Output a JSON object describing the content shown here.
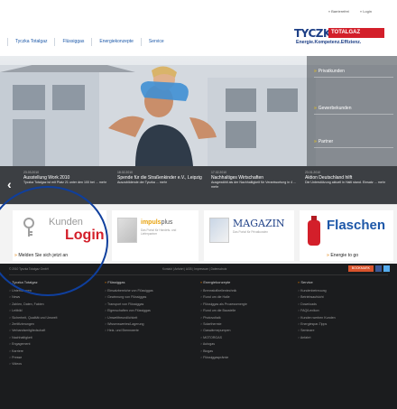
{
  "header": {
    "top_links": [
      "» Barrierefrei",
      "» Login"
    ],
    "nav": [
      "Tyczka Totalgaz",
      "Flüssiggas",
      "Energiekonzepte",
      "Service"
    ],
    "logo": {
      "brand": "TYCZKA",
      "sub": "TOTALGAZ",
      "slogan": "Energie.Kompetenz.Effizienz."
    },
    "colors": {
      "brand_blue": "#1d3f86",
      "brand_red": "#d31f2a"
    }
  },
  "hero": {
    "side_links": [
      "Privatkunden",
      "Gewerbekunden",
      "Partner"
    ]
  },
  "news": [
    {
      "date": "23.03.2010",
      "title": "Ausstellung Work 2010",
      "text": "Tyczka Totalgaz ist mit Platz 21 unter den 100 bei ... mehr"
    },
    {
      "date": "18.02.2010",
      "title": "Spende für die Straßenkinder e.V., Leipzig",
      "text": "Auszubildende der Tyczka ... mehr"
    },
    {
      "date": "17.02.2010",
      "title": "Nachhaltiges Wirtschaften",
      "text": "Ausgewählt als der Nachhaltigkeit für Verantwortung in 4 ... mehr"
    },
    {
      "date": "23.01.2010",
      "title": "Aktion Deutschland hilft",
      "text": "Die Unterstützung aktuell in Haiti stand. Einsatz ... mehr"
    }
  ],
  "teasers": {
    "login": {
      "kunden": "Kunden",
      "login": "Login",
      "link": "Melden Sie sich jetzt an"
    },
    "impuls": {
      "title": "impuls",
      "title2": "plus",
      "sub": "Das Portal für Handels- und Lieferpartner"
    },
    "magazin": {
      "title": "MAGAZIN",
      "sub": "Das Portal für Privatkunden"
    },
    "flaschen": {
      "title": "Flaschen",
      "link": "Energie to go"
    }
  },
  "footer": {
    "copyright": "© 2010 Tyczka Totalgaz GmbH",
    "links": "Kontakt | Anfahrt | AGB | Impressum | Datenschutz",
    "social_label": "BOOKMARK",
    "columns": [
      {
        "head": "Tyczka Totalgaz",
        "items": [
          "Unternehmen",
          "News",
          "Zahlen, Daten, Fakten",
          "Leitbild",
          "Sicherheit, Qualität und Umwelt",
          "Zertifizierungen",
          "Verbandsmitgliedschaft",
          "Nachhaltigkeit",
          "Engagement",
          "Karriere",
          "Presse",
          "Videos"
        ]
      },
      {
        "head": "Flüssiggas",
        "items": [
          "Einsatzbereiche von Flüssiggas",
          "Gewinnung von Flüssiggas",
          "Transport von Flüssiggas",
          "Eigenschaften von Flüssiggas",
          "Umweltfreundlichkeit",
          "Wissenswertes/Lagerung",
          "Heiz- und Brennwerte"
        ]
      },
      {
        "head": "Energiekonzepte",
        "items": [
          "Brennstoffzellentechnik",
          "Rund um die Halle",
          "Flüssiggas als Prozessenergie",
          "Rund um die Baustelle",
          "Photovoltaik",
          "Solarthermie",
          "Gaswärmepumpen",
          "MOTORGAS",
          "Autogas",
          "Biogas",
          "Flüssiggasprämie"
        ]
      },
      {
        "head": "Service",
        "items": [
          "Kundenbetreuung",
          "Betriebsaufsicht",
          "Downloads",
          "FAQ/Lexikon",
          "Kunden werben Kunden",
          "Energiespar-Tipps",
          "Seminare",
          "Anfahrt"
        ]
      }
    ]
  }
}
